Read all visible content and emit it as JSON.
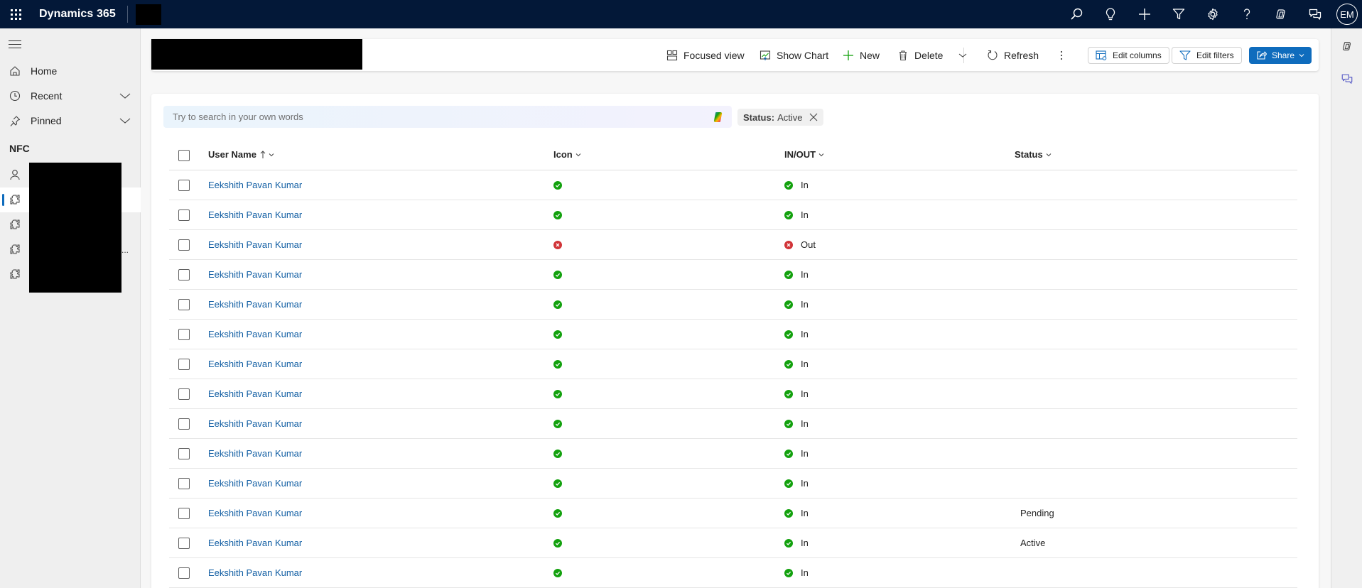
{
  "topbar": {
    "app_title": "Dynamics 365",
    "icons": [
      "search-icon",
      "lightbulb-icon",
      "add-icon",
      "filter-icon",
      "settings-icon",
      "help-icon",
      "copilot-icon",
      "chat-icon"
    ],
    "avatar_initials": "EM"
  },
  "sidebar": {
    "items": [
      {
        "label": "Home",
        "icon": "home-icon"
      },
      {
        "label": "Recent",
        "icon": "clock-icon",
        "expandable": true
      },
      {
        "label": "Pinned",
        "icon": "pin-icon",
        "expandable": true
      }
    ],
    "section_title": "NFC",
    "entities": [
      {
        "icon": "person-icon",
        "selected": false
      },
      {
        "icon": "puzzle-icon",
        "selected": true
      },
      {
        "icon": "puzzle-icon",
        "selected": false
      },
      {
        "icon": "puzzle-icon",
        "selected": false
      },
      {
        "icon": "puzzle-icon",
        "selected": false
      }
    ],
    "overflow_text": "..."
  },
  "commandbar": {
    "focused_view": "Focused view",
    "show_chart": "Show Chart",
    "new": "New",
    "delete": "Delete",
    "refresh": "Refresh",
    "edit_columns": "Edit columns",
    "edit_filters": "Edit filters",
    "share": "Share"
  },
  "search": {
    "placeholder": "Try to search in your own words",
    "value": ""
  },
  "filter_chip": {
    "key": "Status:",
    "value": "Active"
  },
  "table": {
    "columns": [
      {
        "label": "User Name",
        "sorted": "ascending"
      },
      {
        "label": "Icon"
      },
      {
        "label": "IN/OUT"
      },
      {
        "label": "Status"
      }
    ],
    "rows": [
      {
        "user": "Eekshith Pavan Kumar",
        "icon": "check",
        "inout": "In",
        "status": ""
      },
      {
        "user": "Eekshith Pavan Kumar",
        "icon": "check",
        "inout": "In",
        "status": ""
      },
      {
        "user": "Eekshith Pavan Kumar",
        "icon": "cross",
        "inout": "Out",
        "status": ""
      },
      {
        "user": "Eekshith Pavan Kumar",
        "icon": "check",
        "inout": "In",
        "status": ""
      },
      {
        "user": "Eekshith Pavan Kumar",
        "icon": "check",
        "inout": "In",
        "status": ""
      },
      {
        "user": "Eekshith Pavan Kumar",
        "icon": "check",
        "inout": "In",
        "status": ""
      },
      {
        "user": "Eekshith Pavan Kumar",
        "icon": "check",
        "inout": "In",
        "status": ""
      },
      {
        "user": "Eekshith Pavan Kumar",
        "icon": "check",
        "inout": "In",
        "status": ""
      },
      {
        "user": "Eekshith Pavan Kumar",
        "icon": "check",
        "inout": "In",
        "status": ""
      },
      {
        "user": "Eekshith Pavan Kumar",
        "icon": "check",
        "inout": "In",
        "status": ""
      },
      {
        "user": "Eekshith Pavan Kumar",
        "icon": "check",
        "inout": "In",
        "status": ""
      },
      {
        "user": "Eekshith Pavan Kumar",
        "icon": "check",
        "inout": "In",
        "status": "Pending"
      },
      {
        "user": "Eekshith Pavan Kumar",
        "icon": "check",
        "inout": "In",
        "status": "Active"
      },
      {
        "user": "Eekshith Pavan Kumar",
        "icon": "check",
        "inout": "In",
        "status": ""
      }
    ]
  },
  "colors": {
    "topbar_bg": "#031838",
    "accent": "#0f6cbd",
    "link": "#115ea3",
    "status_in": "#13a10e",
    "status_out": "#d13438"
  }
}
